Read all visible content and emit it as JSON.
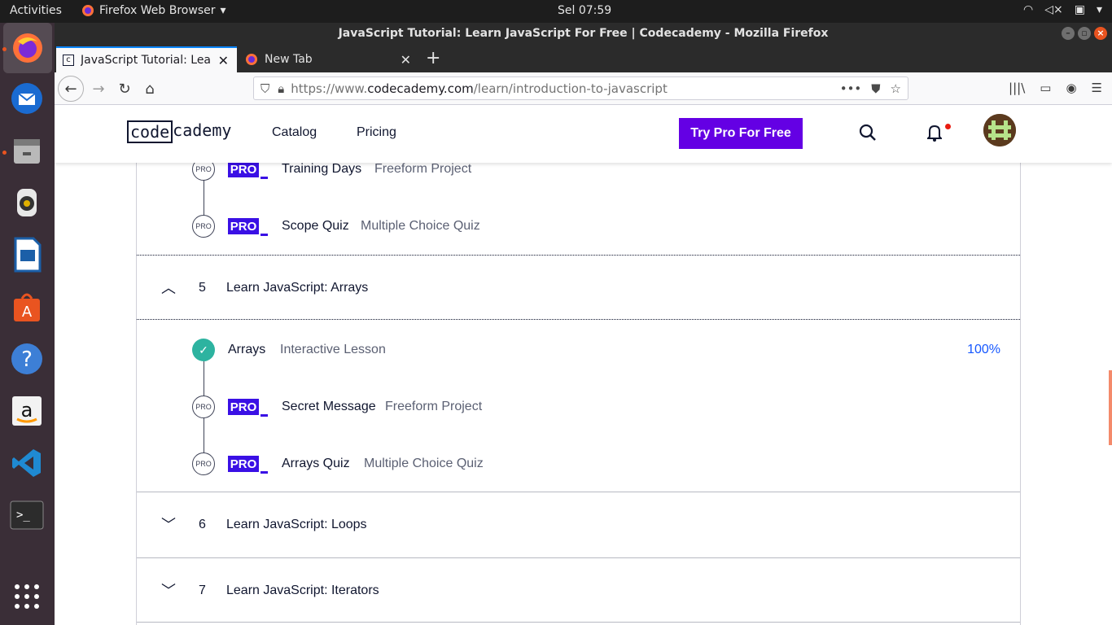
{
  "system": {
    "activities": "Activities",
    "app_menu": "Firefox Web Browser",
    "clock": "Sel 07:59"
  },
  "window": {
    "title": "JavaScript Tutorial: Learn JavaScript For Free | Codecademy - Mozilla Firefox"
  },
  "tabs": [
    {
      "label": "JavaScript Tutorial: Lear"
    },
    {
      "label": "New Tab"
    }
  ],
  "urlbar": {
    "scheme": "https://www.",
    "host": "codecademy.com",
    "path": "/learn/introduction-to-javascript"
  },
  "site": {
    "logo_left": "code",
    "logo_right": "cademy",
    "nav": [
      "Catalog",
      "Pricing"
    ],
    "cta": "Try Pro For Free"
  },
  "syllabus": {
    "top_items": [
      {
        "badge": "PRO",
        "pro": "PRO",
        "title": "Training Days",
        "type": "Freeform Project"
      },
      {
        "badge": "PRO",
        "pro": "PRO",
        "title": "Scope Quiz",
        "type": "Multiple Choice Quiz"
      }
    ],
    "sections": [
      {
        "number": "5",
        "title": "Learn JavaScript: Arrays",
        "expanded": true
      },
      {
        "number": "6",
        "title": "Learn JavaScript: Loops",
        "expanded": false
      },
      {
        "number": "7",
        "title": "Learn JavaScript: Iterators",
        "expanded": false
      }
    ],
    "arrays_items": [
      {
        "title": "Arrays",
        "type": "Interactive Lesson",
        "progress": "100%",
        "completed": true
      },
      {
        "badge": "PRO",
        "pro": "PRO",
        "title": "Secret Message",
        "type": "Freeform Project"
      },
      {
        "badge": "PRO",
        "pro": "PRO",
        "title": "Arrays Quiz",
        "type": "Multiple Choice Quiz"
      }
    ]
  },
  "colors": {
    "brand_purple": "#6400e4",
    "pro_blue": "#3a10e5",
    "complete_teal": "#2db3a0",
    "progress_blue": "#1557ff"
  }
}
